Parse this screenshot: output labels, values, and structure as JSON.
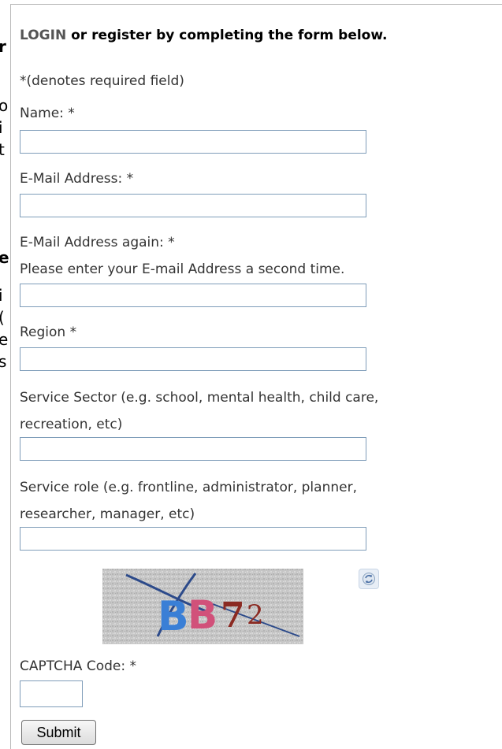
{
  "left_fragments": [
    "r",
    "o",
    "i",
    "t",
    "e",
    "i",
    "(",
    "e",
    "s"
  ],
  "header": {
    "login_link": "LOGIN",
    "rest": " or register by completing the form below."
  },
  "required_note": "*(denotes required field)",
  "fields": {
    "name_label": "Name: *",
    "email_label": "E-Mail Address: *",
    "email_again_label": "E-Mail Address again: *",
    "email_again_hint": "Please enter your E-mail Address a second time.",
    "region_label": "Region *",
    "sector_label_line1": "Service Sector (e.g. school, mental health, child care,",
    "sector_label_line2": "recreation, etc)",
    "role_label_line1": "Service role (e.g. frontline, administrator, planner,",
    "role_label_line2": "researcher, manager, etc)"
  },
  "captcha": {
    "image_text": "BB72",
    "code_label": "CAPTCHA Code: *"
  },
  "submit_label": "Submit",
  "colors": {
    "login_link": "#555555",
    "label_text": "#333333",
    "input_border": "#7f9db9",
    "captcha_blue": "#3a7fd6",
    "captcha_pink": "#d1517a",
    "captcha_brown": "#8b2a22"
  }
}
